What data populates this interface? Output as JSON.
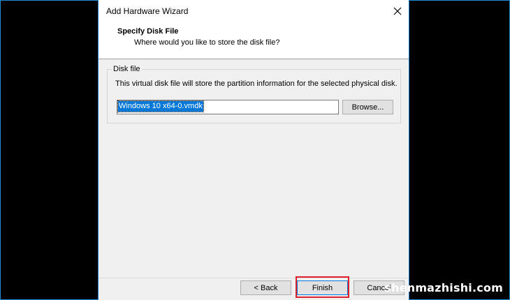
{
  "window": {
    "title": "Add Hardware Wizard"
  },
  "header": {
    "title": "Specify Disk File",
    "subtitle": "Where would you like to store the disk file?"
  },
  "disk_file": {
    "legend": "Disk file",
    "description": "This virtual disk file will store the partition information for the selected physical disk.",
    "path_value": "Windows 10 x64-0.vmdk",
    "browse_label": "Browse..."
  },
  "footer": {
    "back_label": "< Back",
    "finish_label": "Finish",
    "cancel_label": "Cancel"
  },
  "watermark": "shenmazhishi.com",
  "colors": {
    "highlight": "#e0202a",
    "selection": "#0078d7",
    "frame": "#1a8fd8"
  },
  "icons": {
    "close": "close-icon"
  }
}
